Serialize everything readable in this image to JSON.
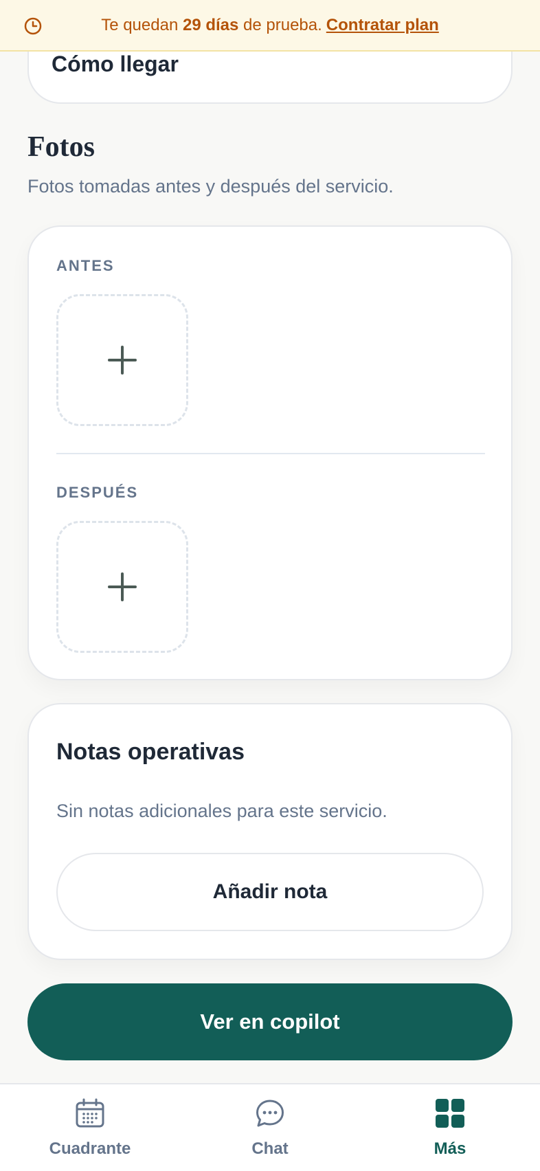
{
  "banner": {
    "prefix": "Te quedan",
    "days": "29 días",
    "suffix": "de prueba.",
    "link": "Contratar plan",
    "icon": "clock-icon"
  },
  "previous_card": {
    "label": "Cómo llegar"
  },
  "photos_section": {
    "title": "Fotos",
    "subtitle": "Fotos tomadas antes y después del servicio.",
    "before_label": "ANTES",
    "after_label": "DESPUÉS",
    "add_icon": "plus-icon"
  },
  "notes": {
    "title": "Notas operativas",
    "empty_text": "Sin notas adicionales para este servicio.",
    "add_button": "Añadir nota"
  },
  "primary_action": {
    "label": "Ver en copilot"
  },
  "bottom_nav": {
    "items": [
      {
        "label": "Cuadrante",
        "icon": "calendar-icon",
        "active": false
      },
      {
        "label": "Chat",
        "icon": "chat-bubble-icon",
        "active": false
      },
      {
        "label": "Más",
        "icon": "grid-icon",
        "active": true
      }
    ]
  },
  "colors": {
    "brand": "#125e57",
    "banner_bg": "#fdf8e6",
    "banner_text": "#b45309",
    "muted_text": "#64748b"
  }
}
